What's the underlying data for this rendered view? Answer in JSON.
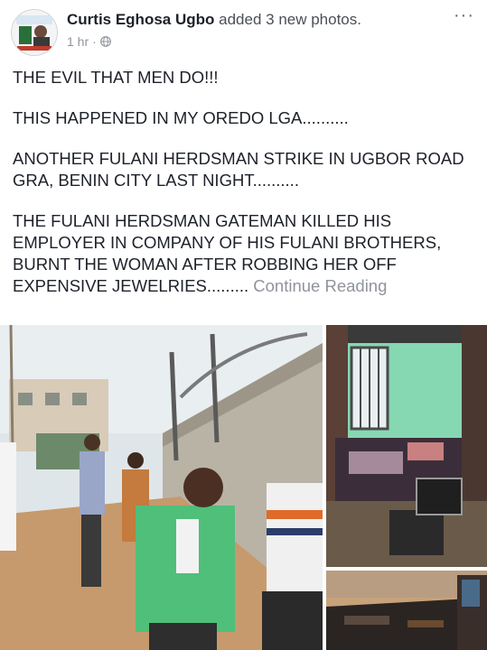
{
  "post": {
    "author": "Curtis Eghosa Ugbo",
    "action": "added 3 new photos.",
    "time": "1 hr",
    "privacy_icon": "globe-icon",
    "more_icon": "more-options-icon",
    "paragraphs": [
      "THE EVIL THAT MEN DO!!!",
      "THIS HAPPENED IN MY OREDO LGA..........",
      "ANOTHER FULANI HERDSMAN STRIKE IN UGBOR ROAD GRA, BENIN CITY LAST NIGHT..........",
      "THE FULANI HERDSMAN GATEMAN KILLED HIS EMPLOYER IN COMPANY OF HIS FULANI BROTHERS, BURNT THE WOMAN AFTER ROBBING HER OFF EXPENSIVE JEWELRIES........."
    ],
    "continue_label": "Continue Reading"
  },
  "colors": {
    "text": "#1d2129",
    "meta": "#90949c",
    "background": "#ffffff"
  }
}
